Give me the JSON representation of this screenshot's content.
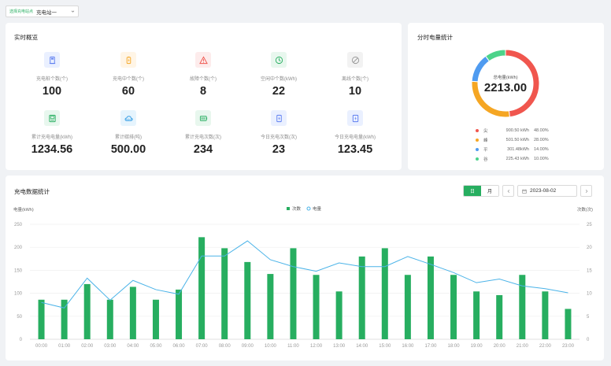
{
  "station": {
    "label": "选择充电站点",
    "value": "充电站一"
  },
  "overview": {
    "title": "实时概览",
    "items": [
      {
        "label": "充电桩个数(个)",
        "value": "100",
        "icon": "charger-pile-icon",
        "color": "#5b7cf0",
        "bg": "#eaf0ff"
      },
      {
        "label": "充电中个数(个)",
        "value": "60",
        "icon": "charging-battery-icon",
        "color": "#f5a623",
        "bg": "#fff5e6"
      },
      {
        "label": "故障个数(个)",
        "value": "8",
        "icon": "warning-icon",
        "color": "#f0564e",
        "bg": "#fdecec"
      },
      {
        "label": "空闲中个数(kWh)",
        "value": "22",
        "icon": "clock-icon",
        "color": "#27ae60",
        "bg": "#e8f7ee"
      },
      {
        "label": "离线个数(个)",
        "value": "10",
        "icon": "offline-icon",
        "color": "#999999",
        "bg": "#f2f2f2"
      },
      {
        "label": "累计充电电量(kWh)",
        "value": "1234.56",
        "icon": "meter-icon",
        "color": "#27ae60",
        "bg": "#e8f7ee"
      },
      {
        "label": "累计碳排(吨)",
        "value": "500.00",
        "icon": "co2-cloud-icon",
        "color": "#3aa0e6",
        "bg": "#e6f4fd"
      },
      {
        "label": "累计充电次数(次)",
        "value": "234",
        "icon": "battery-count-icon",
        "color": "#27ae60",
        "bg": "#e8f7ee"
      },
      {
        "label": "今日充电次数(次)",
        "value": "23",
        "icon": "today-charge-icon",
        "color": "#5b7cf0",
        "bg": "#eaf0ff"
      },
      {
        "label": "今日充电电量(kWh)",
        "value": "123.45",
        "icon": "today-energy-icon",
        "color": "#5b7cf0",
        "bg": "#eaf0ff"
      }
    ]
  },
  "timeshare": {
    "title": "分时电量统计",
    "center_label": "总电量(kWh)",
    "center_value": "2213.00",
    "chart_data": {
      "type": "pie",
      "slices": [
        {
          "name": "尖",
          "kwh": "900.50 kWh",
          "percent": "48.00%",
          "value": 48,
          "color": "#f0564e"
        },
        {
          "name": "峰",
          "kwh": "501.50 kWh",
          "percent": "28.00%",
          "value": 28,
          "color": "#f5a623"
        },
        {
          "name": "平",
          "kwh": "301.48kWh",
          "percent": "14.00%",
          "value": 14,
          "color": "#4f9bf0"
        },
        {
          "name": "谷",
          "kwh": "225.43 kWh",
          "percent": "10.00%",
          "value": 10,
          "color": "#4cd38a"
        }
      ]
    }
  },
  "stats": {
    "title": "充电数据统计",
    "tab_day": "日",
    "tab_month": "月",
    "date": "2023-08-02",
    "chart_data": {
      "type": "bar",
      "categories": [
        "00:00",
        "01:00",
        "02:00",
        "03:00",
        "04:00",
        "05:00",
        "06:00",
        "07:00",
        "08:00",
        "09:00",
        "10:00",
        "11:00",
        "12:00",
        "13:00",
        "14:00",
        "15:00",
        "16:00",
        "17:00",
        "18:00",
        "19:00",
        "20:00",
        "21:00",
        "22:00",
        "23:00"
      ],
      "ylabel_left": "电量(kWh)",
      "ylabel_right": "次数(次)",
      "left_ticks": [
        "0",
        "50",
        "100",
        "150",
        "200",
        "250"
      ],
      "right_ticks": [
        "0",
        "5",
        "10",
        "15",
        "20",
        "25"
      ],
      "ylim_left": [
        0,
        250
      ],
      "ylim_right": [
        0,
        25
      ],
      "series": [
        {
          "name": "次数",
          "type": "bar",
          "axis": "right",
          "color": "#27ae60",
          "values": [
            8.6,
            8.6,
            12,
            8.6,
            11.4,
            8.6,
            10.8,
            22.2,
            19.8,
            16.8,
            14.2,
            19.8,
            14,
            10.4,
            18,
            19.8,
            14,
            18,
            14,
            10.4,
            9.6,
            14,
            10.4,
            6.6
          ]
        },
        {
          "name": "电量",
          "type": "line",
          "axis": "left",
          "color": "#4ab3e8",
          "values": [
            80,
            68,
            133,
            85,
            128,
            108,
            98,
            181,
            181,
            214,
            173,
            158,
            148,
            166,
            158,
            158,
            180,
            163,
            145,
            123,
            131,
            116,
            110,
            101
          ]
        }
      ]
    }
  }
}
